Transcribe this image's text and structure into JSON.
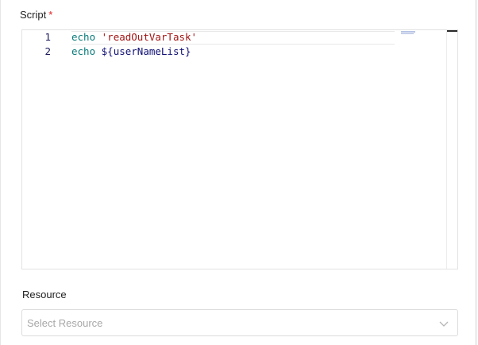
{
  "script_field": {
    "label": "Script",
    "required_mark": "*",
    "lines": [
      {
        "number": "1",
        "keyword": "echo",
        "argument": "'readOutVarTask'",
        "argument_type": "string"
      },
      {
        "number": "2",
        "keyword": "echo",
        "argument": "${userNameList}",
        "argument_type": "variable"
      }
    ]
  },
  "resource_field": {
    "label": "Resource",
    "placeholder": "Select Resource",
    "icon": "chevron-down-icon"
  },
  "colors": {
    "keyword": "#0a7a7a",
    "string": "#a31515",
    "variable": "#101075",
    "required": "#e02020"
  }
}
